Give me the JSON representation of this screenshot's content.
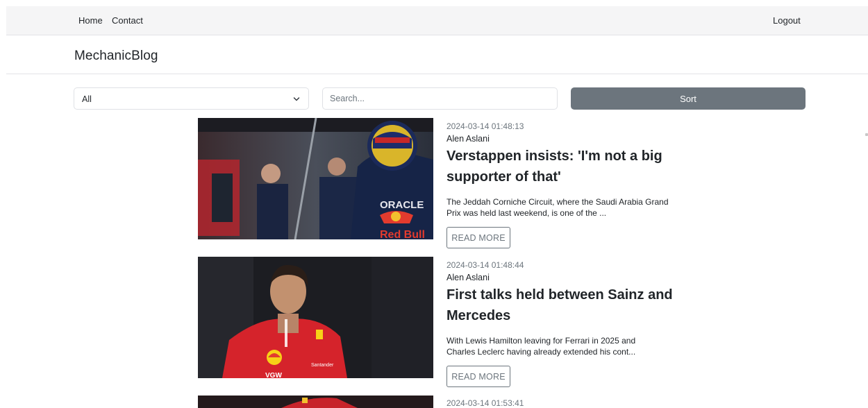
{
  "nav": {
    "home": "Home",
    "contact": "Contact",
    "logout": "Logout"
  },
  "brand": "MechanicBlog",
  "filters": {
    "category_selected": "All",
    "search_placeholder": "Search...",
    "sort_label": "Sort"
  },
  "posts": [
    {
      "date": "2024-03-14 01:48:13",
      "author": "Alen Aslani",
      "title_line1": "Verstappen insists: 'I'm not a big",
      "title_line2": "supporter of that'",
      "excerpt_line1": "The Jeddah Corniche Circuit, where the Saudi Arabia Grand",
      "excerpt_line2": "Prix was held last weekend, is one of the ...",
      "read_more": "READ MORE",
      "image_text_1": "ORACLE",
      "image_text_2": "Red Bull"
    },
    {
      "date": "2024-03-14 01:48:44",
      "author": "Alen Aslani",
      "title_line1": "First talks held between Sainz and",
      "title_line2": "Mercedes",
      "excerpt_line1": "With Lewis Hamilton leaving for Ferrari in 2025 and",
      "excerpt_line2": "Charles Leclerc having already extended his cont...",
      "read_more": "READ MORE",
      "image_text_1": "Santander",
      "image_text_2": "VGW"
    },
    {
      "date": "2024-03-14 01:53:41"
    }
  ]
}
